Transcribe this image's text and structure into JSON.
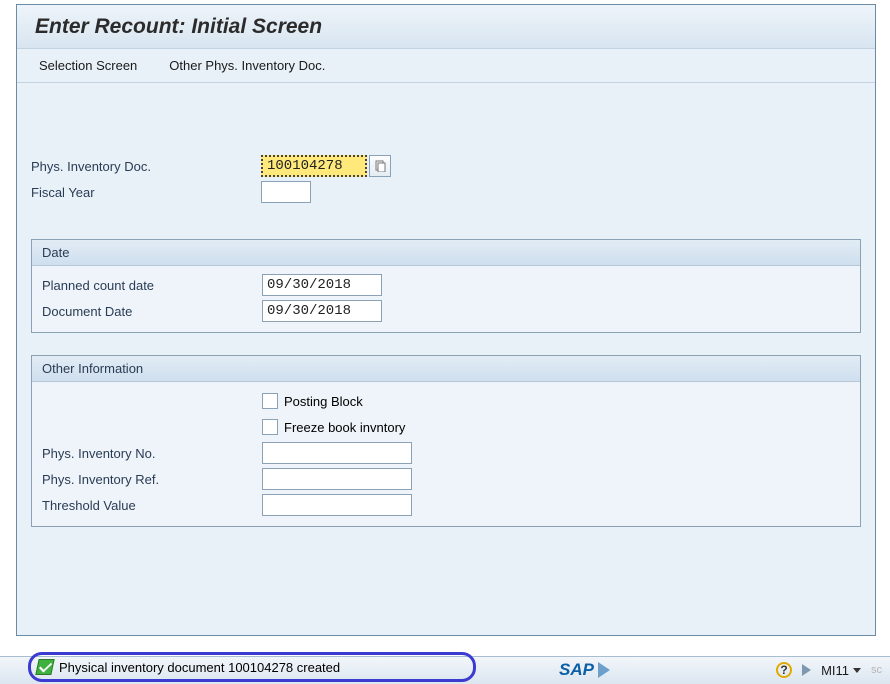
{
  "header": {
    "title": "Enter Recount: Initial Screen"
  },
  "menu": {
    "selection_screen": "Selection Screen",
    "other_doc": "Other Phys. Inventory Doc."
  },
  "fields": {
    "phys_inv_doc_label": "Phys. Inventory Doc.",
    "phys_inv_doc_value": "100104278",
    "fiscal_year_label": "Fiscal Year",
    "fiscal_year_value": ""
  },
  "date_box": {
    "title": "Date",
    "planned_label": "Planned count date",
    "planned_value": "09/30/2018",
    "docdate_label": "Document Date",
    "docdate_value": "09/30/2018"
  },
  "other_box": {
    "title": "Other Information",
    "posting_block_label": "Posting Block",
    "freeze_label": "Freeze book invntory",
    "inv_no_label": "Phys. Inventory No.",
    "inv_no_value": "",
    "inv_ref_label": "Phys. Inventory Ref.",
    "inv_ref_value": "",
    "threshold_label": "Threshold Value",
    "threshold_value": ""
  },
  "status": {
    "message": "Physical inventory document 100104278 created",
    "sap": "SAP",
    "help": "?",
    "tcode": "MI11",
    "trail": "▼",
    "extra": "sc"
  }
}
